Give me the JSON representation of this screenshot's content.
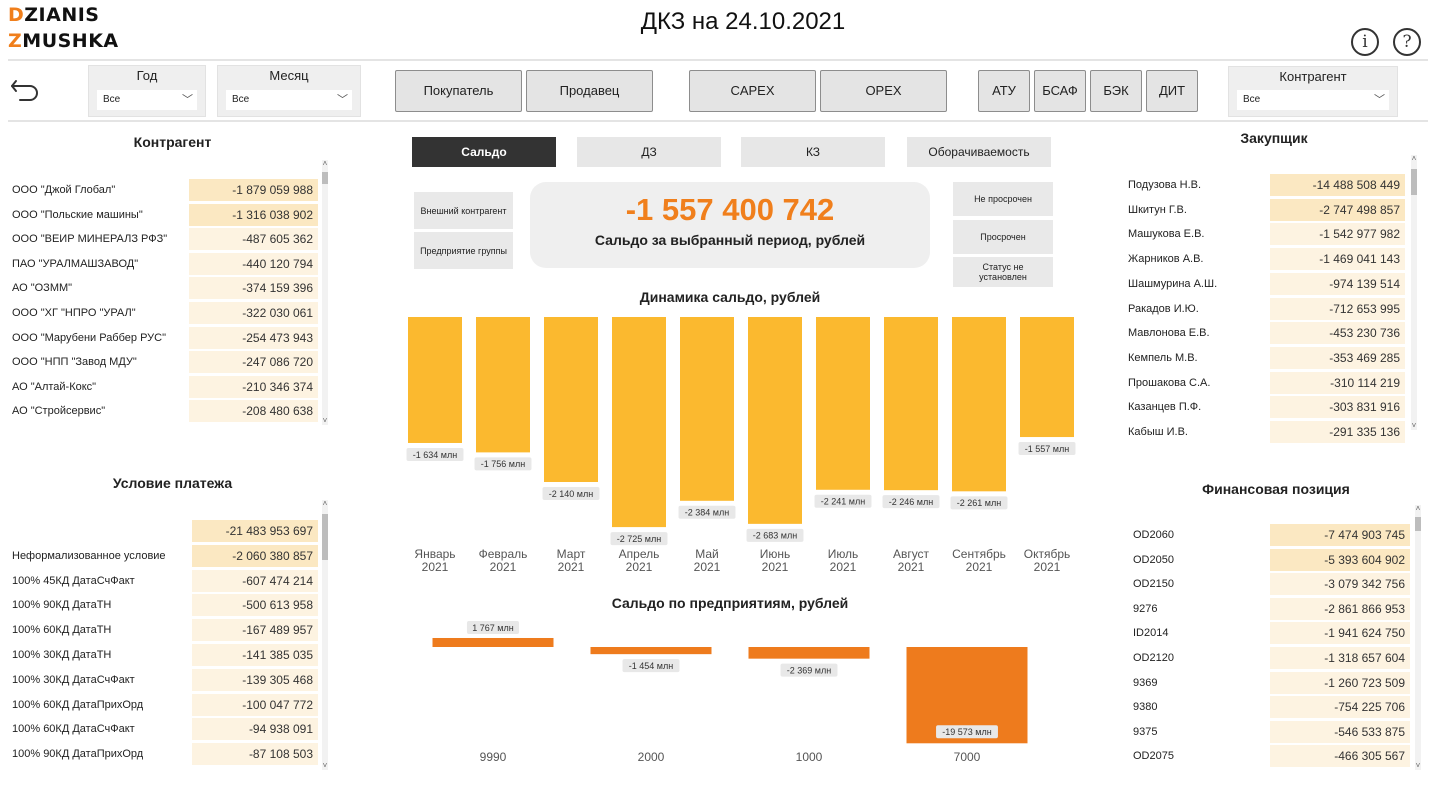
{
  "logo": {
    "line1_accent": "D",
    "line1_rest": "ZIANIS",
    "line2_accent": "Z",
    "line2_rest": "MUSHKA"
  },
  "header": {
    "title": "ДКЗ на  24.10.2021",
    "info_icon": "info-icon",
    "help_icon": "help-icon"
  },
  "toolbar": {
    "back_icon": "back-arrow-icon"
  },
  "filters": {
    "year": {
      "label": "Год",
      "value": "Все"
    },
    "month": {
      "label": "Месяц",
      "value": "Все"
    },
    "counterparty": {
      "label": "Контрагент",
      "value": "Все"
    }
  },
  "buttons": {
    "buyer": "Покупатель",
    "seller": "Продавец",
    "capex": "CAPEX",
    "opex": "OPEX",
    "atu": "АТУ",
    "bsaf": "БСАФ",
    "bek": "БЭК",
    "dit": "ДИТ"
  },
  "tabs": [
    {
      "label": "Сальдо",
      "active": true
    },
    {
      "label": "ДЗ",
      "active": false
    },
    {
      "label": "КЗ",
      "active": false
    },
    {
      "label": "Оборачиваемость",
      "active": false
    }
  ],
  "side_buttons_left": [
    "Внешний контрагент",
    "Предприятие группы"
  ],
  "side_buttons_right": [
    "Не просрочен",
    "Просрочен",
    "Статус не установлен"
  ],
  "kpi": {
    "value": "-1 557 400 742",
    "caption": "Сальдо за выбранный период, рублей"
  },
  "colors": {
    "accent": "#f07f1c",
    "bar_yellow": "#fbb92f",
    "bar_orange": "#ee7b1d",
    "row_highlight": "#fbe8c2"
  },
  "counterparty_table": {
    "title": "Контрагент",
    "rows": [
      {
        "name": "ООО \"Джой Глобал\"",
        "value": "-1 879 059 988"
      },
      {
        "name": "ООО \"Польские машины\"",
        "value": "-1 316 038 902"
      },
      {
        "name": "ООО \"ВЕИР МИНЕРАЛЗ РФЗ\"",
        "value": "-487 605 362"
      },
      {
        "name": "ПАО \"УРАЛМАШЗАВОД\"",
        "value": "-440 120 794"
      },
      {
        "name": "АО \"ОЗММ\"",
        "value": "-374 159 396"
      },
      {
        "name": "ООО \"ХГ \"НПРО \"УРАЛ\"",
        "value": "-322 030 061"
      },
      {
        "name": "ООО \"Марубени Раббер РУС\"",
        "value": "-254 473 943"
      },
      {
        "name": "ООО \"НПП \"Завод МДУ\"",
        "value": "-247 086 720"
      },
      {
        "name": "АО \"Алтай-Кокс\"",
        "value": "-210 346 374"
      },
      {
        "name": "АО \"Стройсервис\"",
        "value": "-208 480 638"
      }
    ]
  },
  "payment_table": {
    "title": "Условие платежа",
    "rows": [
      {
        "name": "",
        "value": "-21 483 953 697"
      },
      {
        "name": "Неформализованное условие",
        "value": "-2 060 380 857"
      },
      {
        "name": "100% 45КД ДатаСчФакт",
        "value": "-607 474 214"
      },
      {
        "name": "100% 90КД ДатаТН",
        "value": "-500 613 958"
      },
      {
        "name": "100% 60КД ДатаТН",
        "value": "-167 489 957"
      },
      {
        "name": "100% 30КД ДатаТН",
        "value": "-141 385 035"
      },
      {
        "name": "100% 30КД ДатаСчФакт",
        "value": "-139 305 468"
      },
      {
        "name": "100% 60КД ДатаПрихОрд",
        "value": "-100 047 772"
      },
      {
        "name": "100% 60КД ДатаСчФакт",
        "value": "-94 938 091"
      },
      {
        "name": "100% 90КД ДатаПрихОрд",
        "value": "-87 108 503"
      }
    ]
  },
  "buyer_table": {
    "title": "Закупщик",
    "rows": [
      {
        "name": "Подузова Н.В.",
        "value": "-14 488 508 449"
      },
      {
        "name": "Шкитун Г.В.",
        "value": "-2 747 498 857"
      },
      {
        "name": "Машукова Е.В.",
        "value": "-1 542 977 982"
      },
      {
        "name": "Жарников А.В.",
        "value": "-1 469 041 143"
      },
      {
        "name": "Шашмурина А.Ш.",
        "value": "-974 139 514"
      },
      {
        "name": "Ракадов И.Ю.",
        "value": "-712 653 995"
      },
      {
        "name": "Мавлонова Е.В.",
        "value": "-453 230 736"
      },
      {
        "name": "Кемпель М.В.",
        "value": "-353 469 285"
      },
      {
        "name": "Прошакова С.А.",
        "value": "-310 114 219"
      },
      {
        "name": "Казанцев П.Ф.",
        "value": "-303 831 916"
      },
      {
        "name": "Кабыш И.В.",
        "value": "-291 335 136"
      }
    ]
  },
  "finpos_table": {
    "title": "Финансовая позиция",
    "rows": [
      {
        "name": "OD2060",
        "value": "-7 474 903 745"
      },
      {
        "name": "OD2050",
        "value": "-5 393 604 902"
      },
      {
        "name": "OD2150",
        "value": "-3 079 342 756"
      },
      {
        "name": "9276",
        "value": "-2 861 866 953"
      },
      {
        "name": "ID2014",
        "value": "-1 941 624 750"
      },
      {
        "name": "OD2120",
        "value": "-1 318 657 604"
      },
      {
        "name": "9369",
        "value": "-1 260 723 509"
      },
      {
        "name": "9380",
        "value": "-754 225 706"
      },
      {
        "name": "9375",
        "value": "-546 533 875"
      },
      {
        "name": "OD2075",
        "value": "-466 305 567"
      }
    ]
  },
  "chart_data": [
    {
      "type": "bar",
      "title": "Динамика сальдо, рублей",
      "categories": [
        "Январь 2021",
        "Февраль 2021",
        "Март 2021",
        "Апрель 2021",
        "Май 2021",
        "Июнь 2021",
        "Июль 2021",
        "Август 2021",
        "Сентябрь 2021",
        "Октябрь 2021"
      ],
      "values": [
        -1634,
        -1756,
        -2140,
        -2725,
        -2384,
        -2683,
        -2241,
        -2246,
        -2261,
        -1557
      ],
      "data_labels": [
        "-1 634 млн",
        "-1 756 млн",
        "-2 140 млн",
        "-2 725 млн",
        "-2 384 млн",
        "-2 683 млн",
        "-2 241 млн",
        "-2 246 млн",
        "-2 261 млн",
        "-1 557 млн"
      ],
      "unit": "млн",
      "color": "#fbb92f"
    },
    {
      "type": "bar",
      "title": "Сальдо по предприятиям, рублей",
      "categories": [
        "9990",
        "2000",
        "1000",
        "7000"
      ],
      "values": [
        1767,
        -1454,
        -2369,
        -19573
      ],
      "data_labels": [
        "1 767 млн",
        "-1 454 млн",
        "-2 369 млн",
        "-19 573 млн"
      ],
      "unit": "млн",
      "color": "#ee7b1d"
    }
  ]
}
